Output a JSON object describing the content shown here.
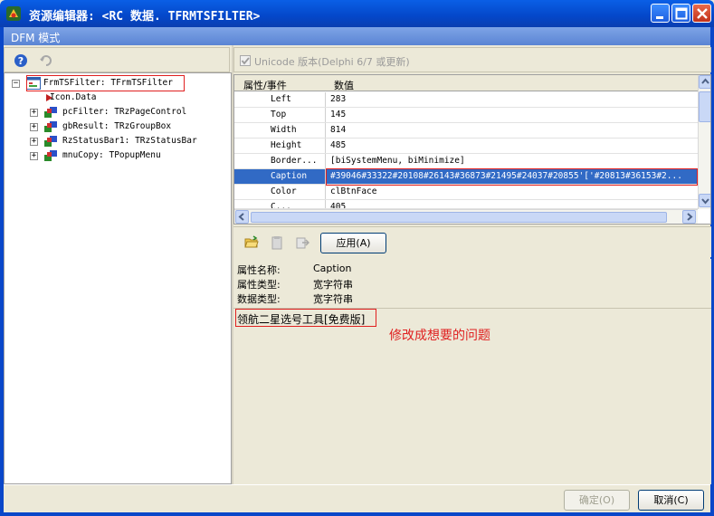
{
  "window": {
    "title": "资源编辑器: <RC 数据. TFRMTSFILTER>",
    "mode_label": "DFM 模式"
  },
  "tree": {
    "root": "FrmTSFilter: TFrmTSFilter",
    "children": [
      "Icon.Data",
      "pcFilter: TRzPageControl",
      "gbResult: TRzGroupBox",
      "RzStatusBar1: TRzStatusBar",
      "mnuCopy: TPopupMenu"
    ]
  },
  "unicode_option": {
    "label": "Unicode 版本(Delphi 6/7 或更新)",
    "checked": true
  },
  "grid": {
    "headers": {
      "property": "属性/事件",
      "value": "数值"
    },
    "rows": [
      {
        "name": "Left",
        "value": "283"
      },
      {
        "name": "Top",
        "value": "145"
      },
      {
        "name": "Width",
        "value": "814"
      },
      {
        "name": "Height",
        "value": "485"
      },
      {
        "name": "Border...",
        "value": "[biSystemMenu, biMinimize]"
      },
      {
        "name": "Caption",
        "value": "#39046#33322#20108#26143#36873#21495#24037#20855'['#20813#36153#2..."
      },
      {
        "name": "Color",
        "value": "clBtnFace"
      },
      {
        "name": "C...",
        "value": "405"
      }
    ],
    "selected": "Caption"
  },
  "toolbar": {
    "apply_label": "应用(A)"
  },
  "info": {
    "rows": [
      {
        "key": "属性名称:",
        "value": "Caption"
      },
      {
        "key": "属性类型:",
        "value": "宽字符串"
      },
      {
        "key": "数据类型:",
        "value": "宽字符串"
      }
    ]
  },
  "editor": {
    "text": "领航二星选号工具[免费版]"
  },
  "annotation": "修改成想要的问题",
  "buttons": {
    "ok": "确定(O)",
    "cancel": "取消(C)"
  },
  "colors": {
    "title_bar": "#0a5fe6",
    "selection": "#316ac5",
    "highlight_box": "#e02020"
  }
}
